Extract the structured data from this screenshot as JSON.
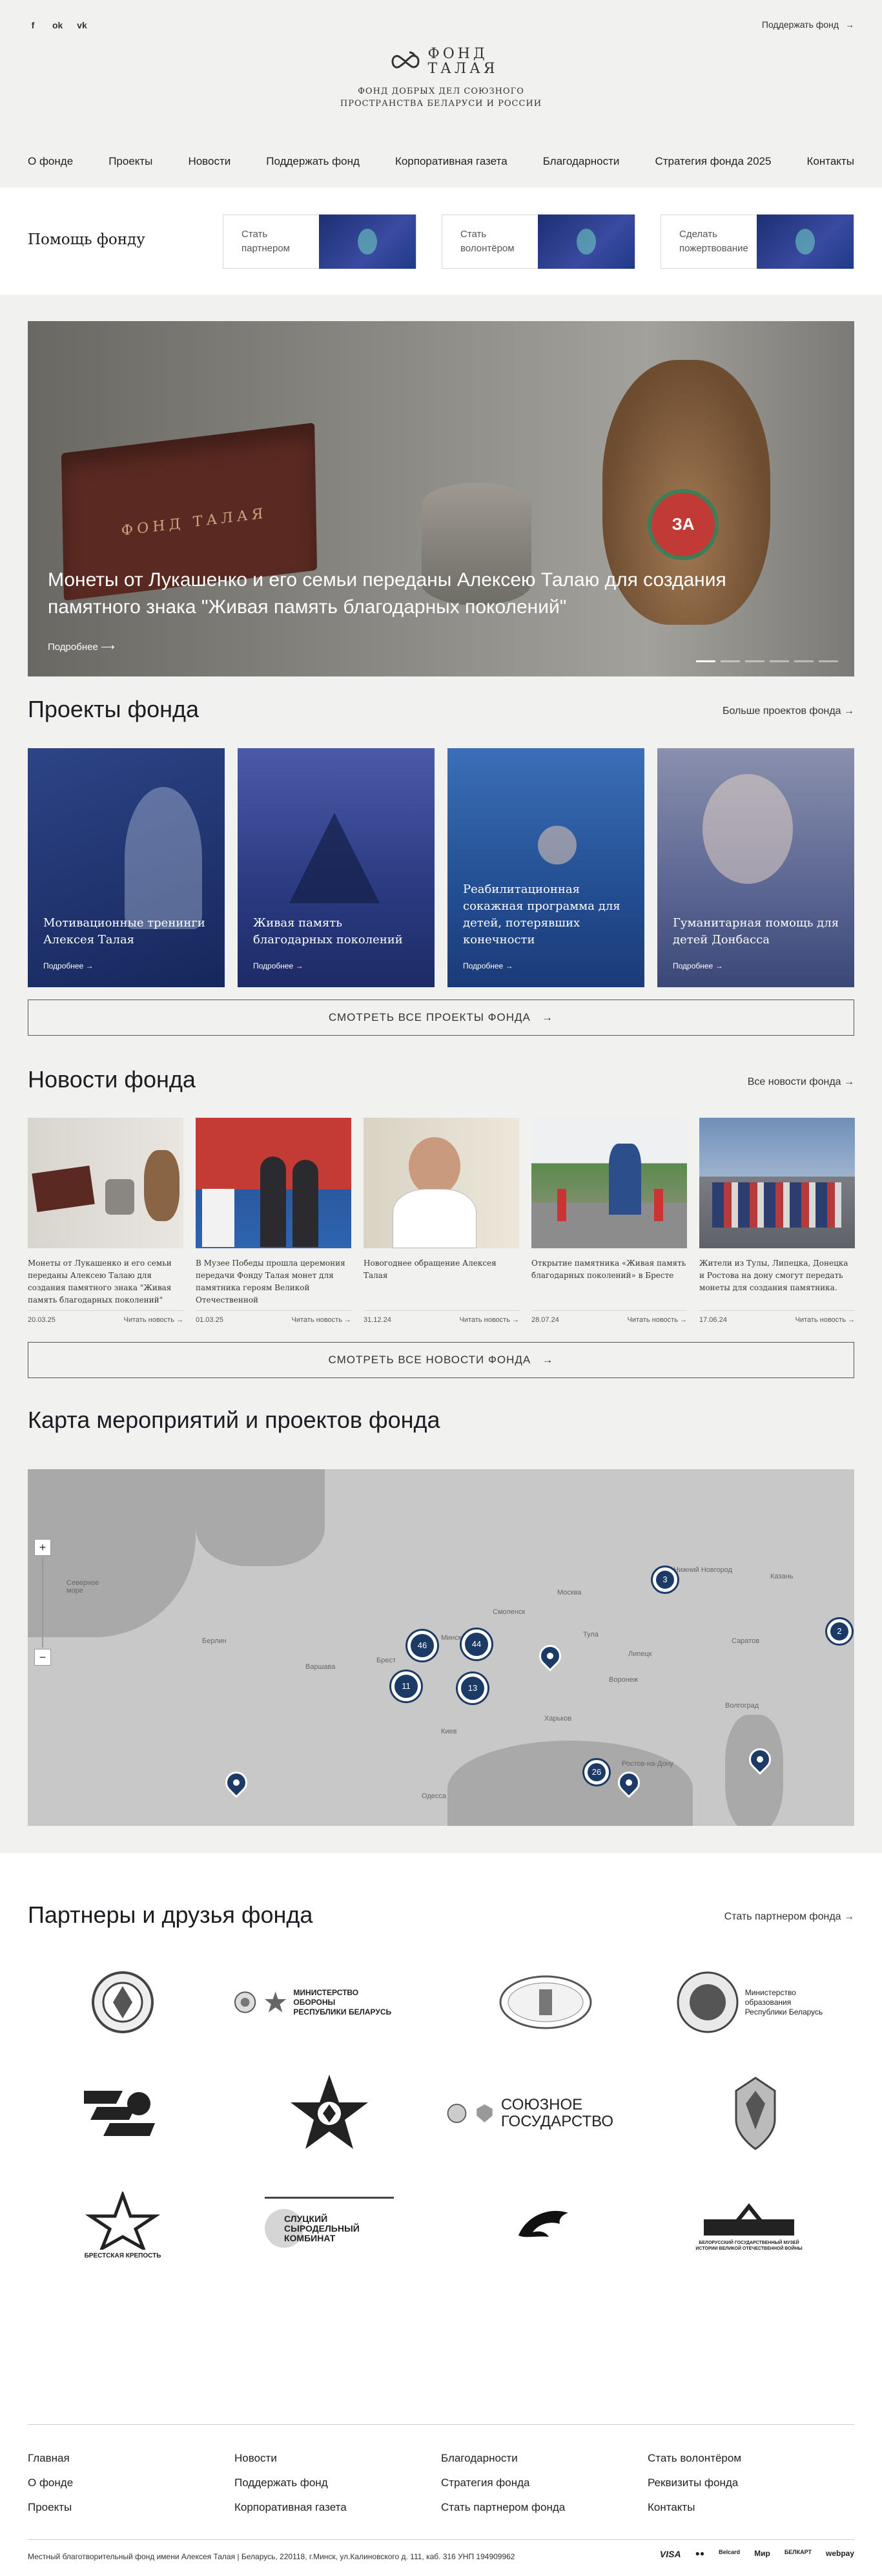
{
  "header": {
    "socials": [
      "f",
      "ok",
      "vk"
    ],
    "support_link": "Поддержать фонд",
    "logo_line1": "ФОНД",
    "logo_line2": "ТАЛАЯ",
    "tagline_1": "ФОНД ДОБРЫХ ДЕЛ СОЮЗНОГО",
    "tagline_2": "ПРОСТРАНСТВА БЕЛАРУСИ И РОССИИ",
    "nav": [
      "О фонде",
      "Проекты",
      "Новости",
      "Поддержать фонд",
      "Корпоративная газета",
      "Благодарности",
      "Стратегия фонда 2025",
      "Контакты"
    ]
  },
  "help": {
    "title": "Помощь фонду",
    "cards": [
      {
        "label_1": "Стать",
        "label_2": "партнером"
      },
      {
        "label_1": "Стать",
        "label_2": "волонтёром"
      },
      {
        "label_1": "Сделать",
        "label_2": "пожертвование"
      }
    ]
  },
  "slider": {
    "title": "Монеты от Лукашенко и его семьи переданы Алексею Талаю для создания памятного знака \"Живая память благодарных поколений\"",
    "more": "Подробнее",
    "box_brand": "ФОНД ТАЛАЯ",
    "badge": "ЗА"
  },
  "projects": {
    "title": "Проекты фонда",
    "more_link": "Больше проектов фонда",
    "items": [
      {
        "title": "Мотивационные тренинги Алексея Талая",
        "more": "Подробнее",
        "color": "#22356f"
      },
      {
        "title": "Живая память благодарных поколений",
        "more": "Подробнее",
        "color": "#2c3f86"
      },
      {
        "title": "Реабилитационная сокажная программа для детей, потерявших конечности",
        "more": "Подробнее",
        "color": "#2a4c8e"
      },
      {
        "title": "Гуманитарная помощь для детей Донбасса",
        "more": "Подробнее",
        "color": "#4d5a8a"
      }
    ],
    "all_button": "СМОТРЕТЬ ВСЕ ПРОЕКТЫ ФОНДА"
  },
  "news": {
    "title": "Новости фонда",
    "more_link": "Все новости фонда",
    "items": [
      {
        "title": "Монеты от Лукашенко и его семьи переданы Алексею Талаю для создания памятного знака \"Живая память благодарных поколений\"",
        "date": "20.03.25",
        "read": "Читать новость"
      },
      {
        "title": "В Музее Победы прошла церемония передачи Фонду Талая монет для памятника героям Великой Отечественной",
        "date": "01.03.25",
        "read": "Читать новость"
      },
      {
        "title": "Новогоднее обращение Алексея Талая",
        "date": "31.12.24",
        "read": "Читать новость"
      },
      {
        "title": "Открытие памятника «Живая память благодарных поколений» в Бресте",
        "date": "28.07.24",
        "read": "Читать новость"
      },
      {
        "title": "Жители из Тулы, Липецка, Донецка и Ростова на дону смогут передать монеты для создания памятника.",
        "date": "17.06.24",
        "read": "Читать новость"
      }
    ],
    "all_button": "СМОТРЕТЬ ВСЕ НОВОСТИ ФОНДА"
  },
  "map": {
    "title": "Карта мероприятий и проектов фонда",
    "zoom_in": "+",
    "zoom_out": "−",
    "sea_label_1": "Северное",
    "sea_label_2": "море",
    "cities": [
      "Москва",
      "Минск",
      "Киев",
      "Варшава",
      "Берлин",
      "Харьков",
      "Брест",
      "Одесса",
      "Воронеж",
      "Смоленск",
      "Тула",
      "Липецк",
      "Ростов-на-Дону",
      "Волгоград",
      "Саратов",
      "Казань",
      "Нижний Новгород"
    ],
    "clusters": [
      "3",
      "2",
      "46",
      "44",
      "11",
      "13",
      "26"
    ]
  },
  "partners": {
    "title": "Партнеры и друзья фонда",
    "more_link": "Стать партнером фонда",
    "names": {
      "mod_1": "МИНИСТЕРСТВО ОБОРОНЫ",
      "mod_2": "РЕСПУБЛИКИ БЕЛАРУСЬ",
      "edu_1": "Министерство",
      "edu_2": "образования",
      "edu_3": "Республики Беларусь",
      "union_1": "СОЮЗНОЕ",
      "union_2": "ГОСУДАРСТВО",
      "brest": "БРЕСТСКАЯ КРЕПОСТЬ",
      "sluck_1": "СЛУЦКИЙ",
      "sluck_2": "СЫРОДЕЛЬНЫЙ",
      "sluck_3": "КОМБИНАТ",
      "museum_1": "БЕЛОРУССКИЙ ГОСУДАРСТВЕННЫЙ МУЗЕЙ",
      "museum_2": "ИСТОРИИ ВЕЛИКОЙ ОТЕЧЕСТВЕННОЙ ВОЙНЫ"
    }
  },
  "footer": {
    "col1": [
      "Главная",
      "О фонде",
      "Проекты"
    ],
    "col2": [
      "Новости",
      "Поддержать фонд",
      "Корпоративная газета"
    ],
    "col3": [
      "Благодарности",
      "Стратегия фонда",
      "Стать партнером фонда"
    ],
    "col4": [
      "Стать волонтёром",
      "Реквизиты фонда",
      "Контакты"
    ],
    "legal": "Местный благотворительный фонд имени Алексея Талая | Беларусь, 220118, г.Минск, ул.Калиновского д. 111, каб. 316 УНП 194909962",
    "payments": [
      "VISA",
      "●●",
      "Belcard",
      "Мир",
      "БЕЛКАРТ",
      "webpay"
    ]
  },
  "colors": {
    "accent": "#1b3a66",
    "background": "#f1f1ef"
  }
}
